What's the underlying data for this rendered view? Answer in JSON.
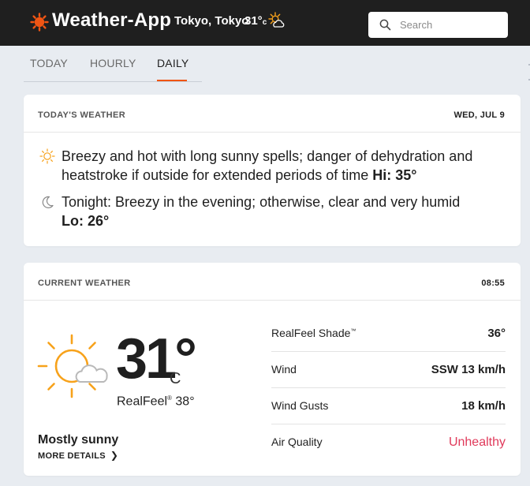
{
  "app": {
    "name": "Weather-App",
    "location": "Tokyo, Tokyo",
    "temp": "31°",
    "unit": "c",
    "icon": "partly-sunny-icon"
  },
  "search": {
    "placeholder": "Search"
  },
  "tabs": [
    {
      "label": "TODAY"
    },
    {
      "label": "HOURLY"
    },
    {
      "label": "DAILY",
      "active": true
    }
  ],
  "today": {
    "title": "TODAY'S WEATHER",
    "date": "WED, JUL 9",
    "day_text": "Breezy and hot with long sunny spells; danger of dehydration and heatstroke if outside for extended periods of time",
    "day_hi": "Hi: 35°",
    "night_text": "Tonight: Breezy in the evening; otherwise, clear and very humid",
    "night_lo": "Lo: 26°"
  },
  "current": {
    "title": "CURRENT WEATHER",
    "time": "08:55",
    "temp": "31°",
    "unit": "C",
    "realfeel_label": "RealFeel",
    "realfeel_mark": "®",
    "realfeel_value": "38°",
    "phrase": "Mostly sunny",
    "more_details": "MORE DETAILS",
    "details": [
      {
        "label": "RealFeel Shade",
        "mark": "™",
        "value": "36°"
      },
      {
        "label": "Wind",
        "mark": "",
        "value": "SSW 13 km/h"
      },
      {
        "label": "Wind Gusts",
        "mark": "",
        "value": "18 km/h"
      },
      {
        "label": "Air Quality",
        "mark": "",
        "value": "Unhealthy"
      }
    ]
  },
  "colors": {
    "accent": "#f05514",
    "sun": "#f7a21b",
    "bad": "#e0395a",
    "header": "#1f1f1f",
    "background": "#e8ecf1"
  }
}
